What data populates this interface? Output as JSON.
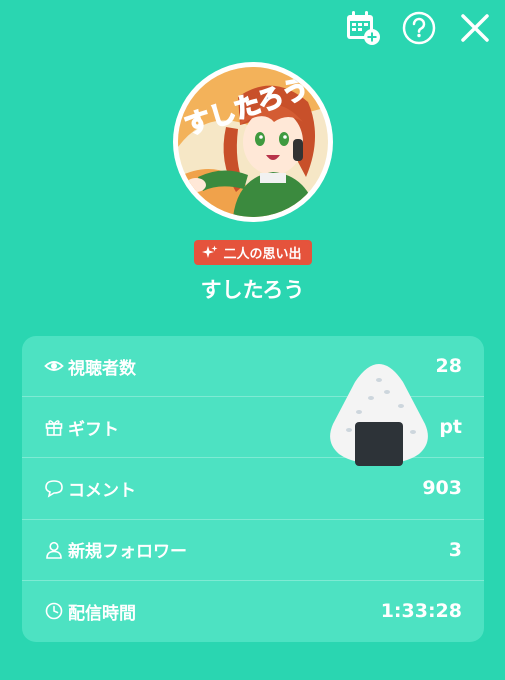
{
  "topbar": {
    "icons": [
      "calendar-add-icon",
      "help-icon",
      "close-icon"
    ]
  },
  "badge": {
    "icon": "sparkle-icon",
    "label": "二人の思い出"
  },
  "user": {
    "name": "すしたろう",
    "avatar_text": "すしたろう"
  },
  "stats": [
    {
      "icon": "eye-icon",
      "label": "視聴者数",
      "value": "28"
    },
    {
      "icon": "gift-icon",
      "label": "ギフト",
      "value": "pt"
    },
    {
      "icon": "comment-icon",
      "label": "コメント",
      "value": "903"
    },
    {
      "icon": "person-icon",
      "label": "新規フォロワー",
      "value": "3"
    },
    {
      "icon": "clock-icon",
      "label": "配信時間",
      "value": "1:33:28"
    }
  ],
  "colors": {
    "background": "#2ad6b1",
    "card": "#4de2c2",
    "badge": "#e5533c"
  }
}
